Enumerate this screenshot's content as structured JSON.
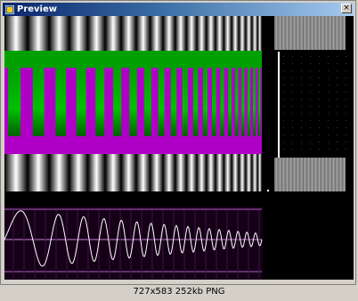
{
  "window": {
    "title": "Preview",
    "close_glyph": "×",
    "icon": "preview-app-icon"
  },
  "image": {
    "description_caption": "727x583 252kb PNG"
  },
  "colors": {
    "titlebar_start": "#0a246a",
    "titlebar_end": "#a6caf0",
    "green": "#00a000",
    "magenta": "#b000c8",
    "waveform_trace": "#ffffff",
    "waveform_band": "#b060c0"
  }
}
